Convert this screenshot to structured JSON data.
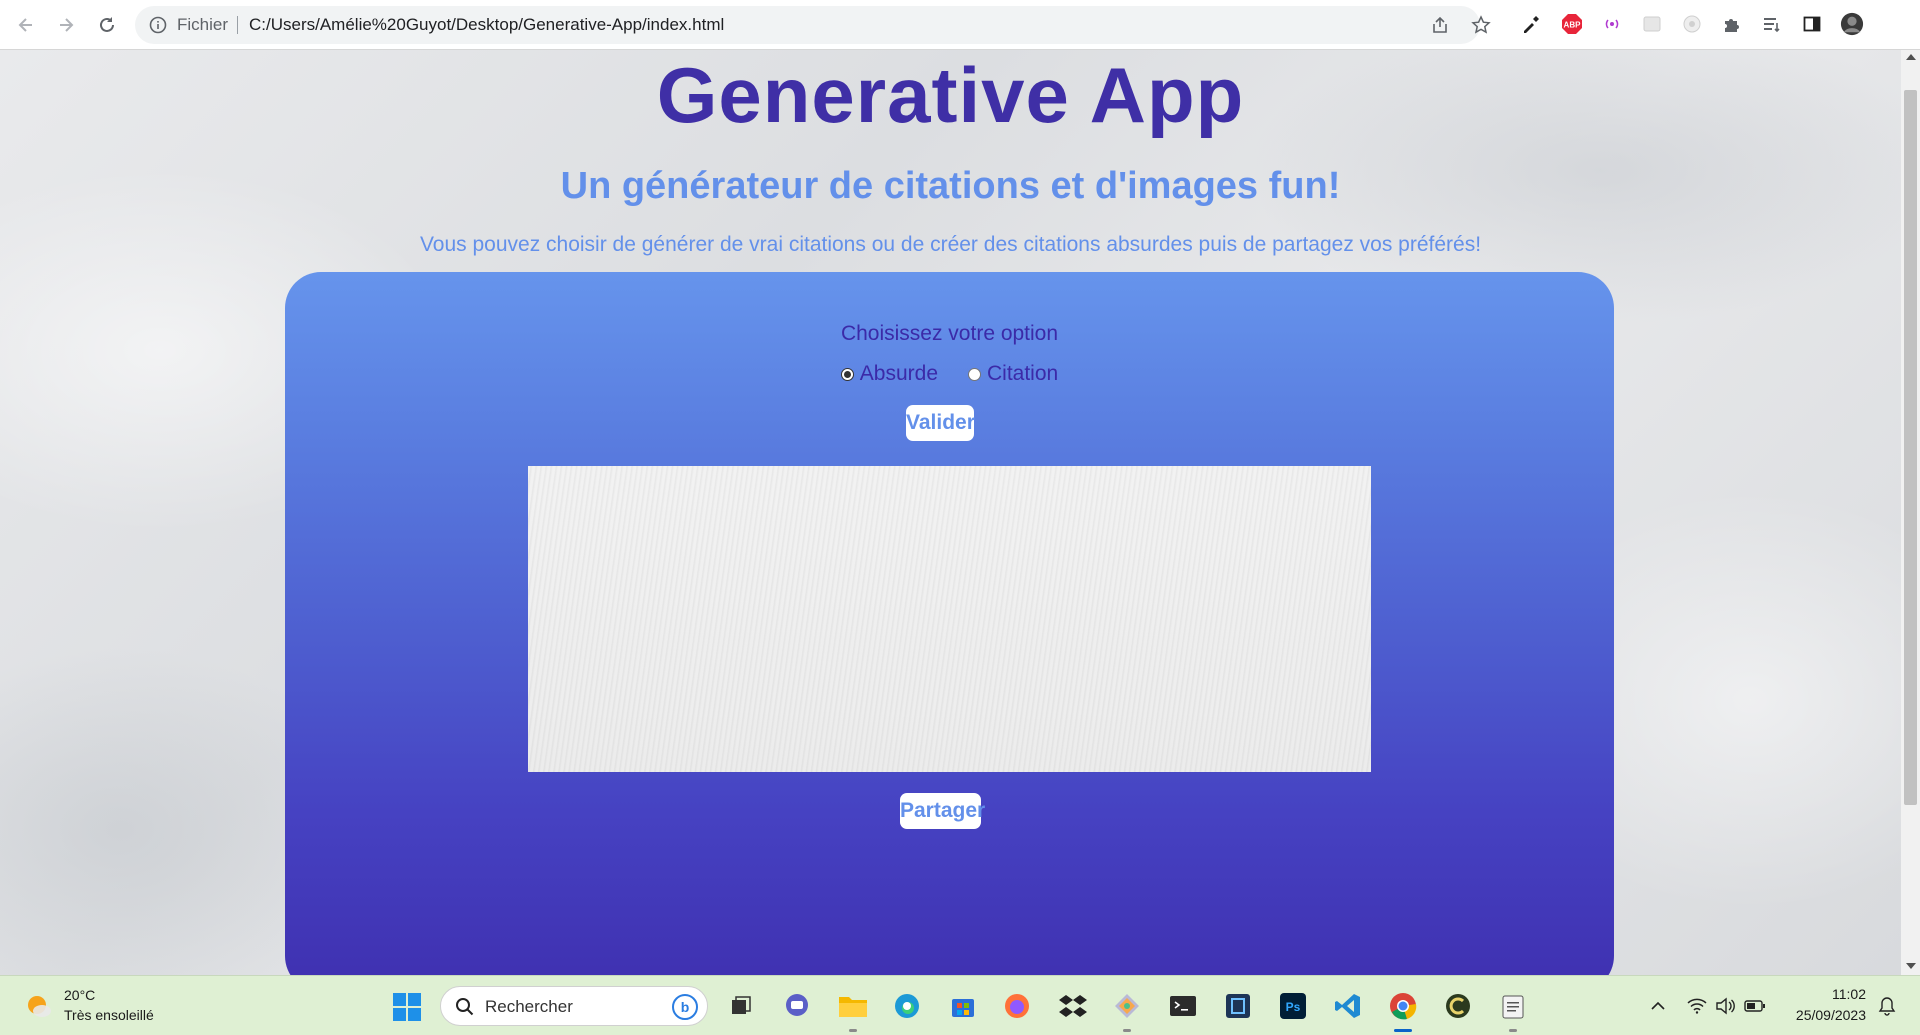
{
  "browser": {
    "scheme_label": "Fichier",
    "url": "C:/Users/Amélie%20Guyot/Desktop/Generative-App/index.html",
    "extensions": [
      "eyedropper-icon",
      "adblock-plus-icon",
      "broadcast-icon",
      "extension-blank-icon",
      "extension-circle-icon",
      "puzzle-icon",
      "reading-list-icon",
      "side-panel-icon",
      "profile-avatar"
    ],
    "adblock_label": "ABP"
  },
  "page": {
    "title": "Generative App",
    "subtitle": "Un générateur de citations et d'images fun!",
    "description": "Vous pouvez choisir de générer de vrai citations ou de créer des citations absurdes puis de partagez vos préférés!",
    "option_title": "Choisissez votre option",
    "options": [
      {
        "label": "Absurde",
        "checked": true
      },
      {
        "label": "Citation",
        "checked": false
      }
    ],
    "validate_label": "Valider",
    "share_label": "Partager",
    "colors": {
      "title": "#3f2fa6",
      "accent": "#6390ea",
      "panel_top": "#6694ec",
      "panel_bottom": "#3f30b0"
    }
  },
  "taskbar": {
    "weather_temp": "20°C",
    "weather_desc": "Très ensoleillé",
    "search_placeholder": "Rechercher",
    "apps": [
      "task-view-icon",
      "chat-icon",
      "file-explorer-icon",
      "edge-icon",
      "store-icon",
      "firefox-icon",
      "dropbox-icon",
      "gitkraken-icon",
      "terminal-icon",
      "app-icon",
      "photoshop-icon",
      "vscode-icon",
      "chrome-icon",
      "app-c-icon",
      "notepad-icon"
    ],
    "time": "11:02",
    "date": "25/09/2023"
  }
}
